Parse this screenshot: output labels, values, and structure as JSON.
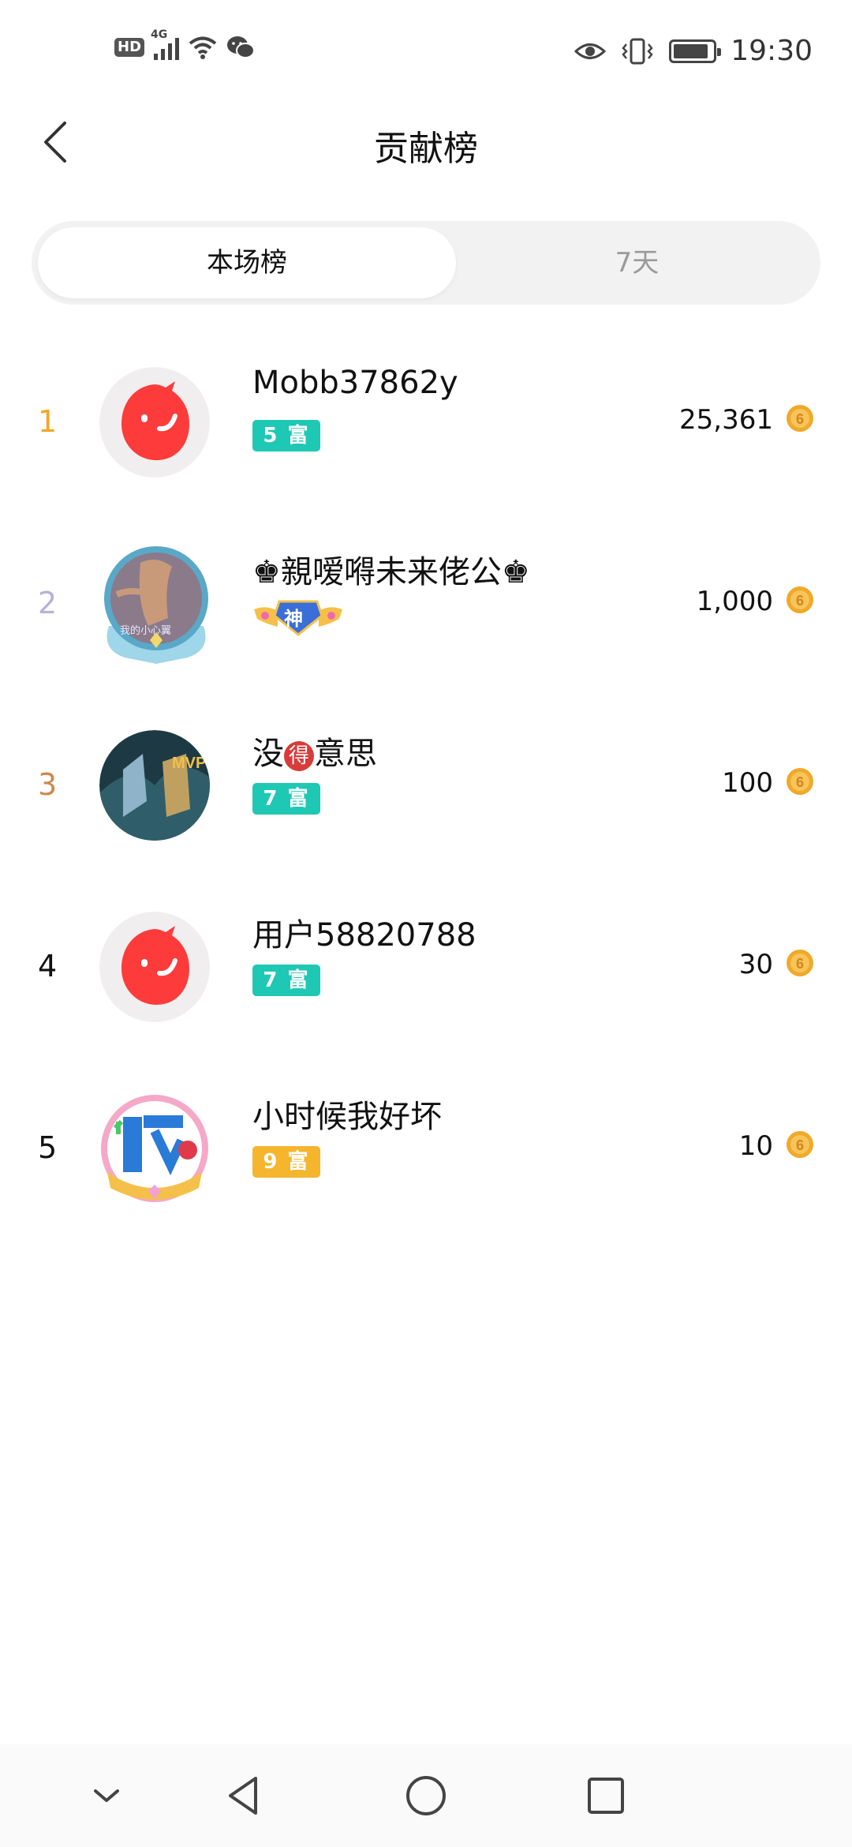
{
  "status_bar": {
    "hd": "HD",
    "network": "4G",
    "time": "19:30",
    "battery_level": 0.9
  },
  "header": {
    "title": "贡献榜"
  },
  "tabs": [
    {
      "label": "本场榜",
      "active": true
    },
    {
      "label": "7天",
      "active": false
    }
  ],
  "colors": {
    "rank1": "#f5a623",
    "rank2": "#b8b0d8",
    "rank3": "#c98a4a",
    "rank_default": "#111111",
    "badge_teal": "#1ec8b4",
    "badge_orange": "#f5b52c",
    "coin": "#f0a92a"
  },
  "ranking": [
    {
      "rank": "1",
      "name": "Mobb37862y",
      "badge": "5 富",
      "badge_type": "teal",
      "score": "25,361",
      "avatar": "kuaishou-logo"
    },
    {
      "rank": "2",
      "name": "♚親嗳嘚未来佬公♚",
      "badge": "神",
      "badge_type": "shen-wings",
      "score": "1,000",
      "avatar": "cartoon-avatar-with-frame"
    },
    {
      "rank": "3",
      "name": "没得意思",
      "name_parts": [
        "没",
        "得",
        "意思"
      ],
      "badge": "7 富",
      "badge_type": "teal",
      "score": "100",
      "avatar": "game-mvp-avatar"
    },
    {
      "rank": "4",
      "name": "用户58820788",
      "badge": "7 富",
      "badge_type": "teal",
      "score": "30",
      "avatar": "kuaishou-logo"
    },
    {
      "rank": "5",
      "name": "小时候我好坏",
      "badge": "9 富",
      "badge_type": "orange",
      "score": "10",
      "avatar": "huai-character-avatar"
    }
  ]
}
